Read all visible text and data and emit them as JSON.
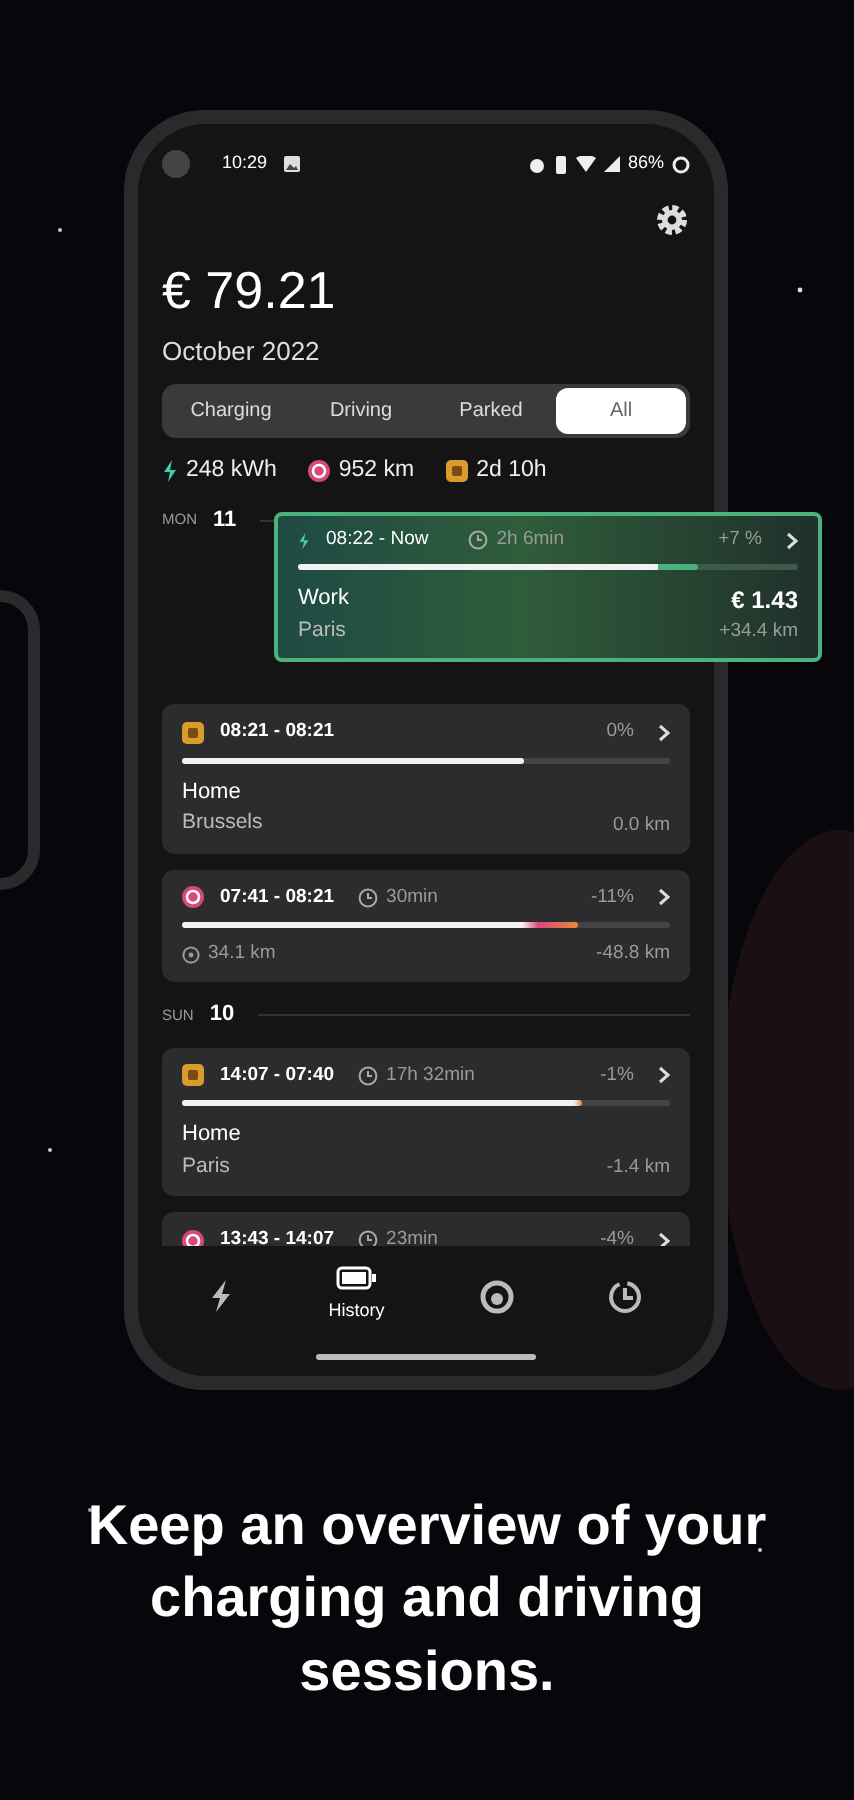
{
  "status_bar": {
    "time": "10:29",
    "battery": "86%"
  },
  "summary": {
    "total": "€ 79.21",
    "period": "October 2022"
  },
  "filters": [
    {
      "label": "Charging",
      "selected": false
    },
    {
      "label": "Driving",
      "selected": false
    },
    {
      "label": "Parked",
      "selected": false
    },
    {
      "label": "All",
      "selected": true
    }
  ],
  "stats": [
    {
      "kind": "energy",
      "value": "248 kWh"
    },
    {
      "kind": "distance",
      "value": "952 km"
    },
    {
      "kind": "parked",
      "value": "2d 10h"
    }
  ],
  "days": [
    {
      "weekday": "MON",
      "day": "11",
      "sessions": [
        {
          "kind": "parked",
          "time": "08:21 - 08:21",
          "change": "0%",
          "level": 0.7,
          "place": "Home",
          "city": "Brussels",
          "distance": "0.0 km"
        },
        {
          "kind": "driving",
          "time": "07:41 - 08:21",
          "duration": "30min",
          "change": "-11%",
          "level": 0.81,
          "trip": "34.1 km",
          "distance": "-48.8 km"
        }
      ]
    },
    {
      "weekday": "SUN",
      "day": "10",
      "sessions": [
        {
          "kind": "parked",
          "time": "14:07 - 07:40",
          "duration": "17h 32min",
          "change": "-1%",
          "level": 0.82,
          "place": "Home",
          "city": "Paris",
          "distance": "-1.4 km"
        },
        {
          "kind": "driving",
          "time": "13:43 - 14:07",
          "duration": "23min",
          "change": "-4%"
        }
      ]
    }
  ],
  "active_session": {
    "kind": "charging",
    "time": "08:22 - Now",
    "duration": "2h 6min",
    "change": "+7 %",
    "level": 0.8,
    "place": "Work",
    "city": "Paris",
    "cost": "€ 1.43",
    "distance": "+34.4 km"
  },
  "nav": [
    {
      "kind": "charging",
      "selected": false
    },
    {
      "kind": "history",
      "label": "History",
      "selected": true
    },
    {
      "kind": "driving",
      "selected": false
    },
    {
      "kind": "parked",
      "selected": false
    }
  ],
  "caption": "Keep an overview of your charging and driving sessions."
}
